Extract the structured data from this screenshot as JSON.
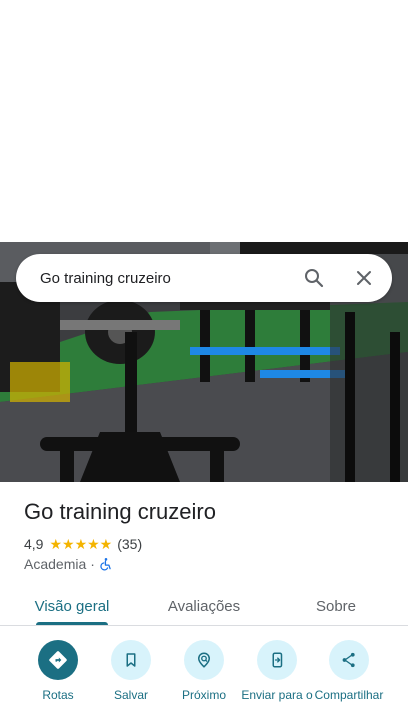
{
  "search": {
    "query": "Go training cruzeiro"
  },
  "place": {
    "title": "Go training cruzeiro",
    "rating": "4,9",
    "stars": "★★★★★",
    "review_count": "(35)",
    "category": "Academia",
    "separator": "·"
  },
  "tabs": [
    {
      "label": "Visão geral",
      "active": true
    },
    {
      "label": "Avaliações",
      "active": false
    },
    {
      "label": "Sobre",
      "active": false
    }
  ],
  "actions": [
    {
      "label": "Rotas",
      "icon": "directions-icon"
    },
    {
      "label": "Salvar",
      "icon": "bookmark-icon"
    },
    {
      "label": "Próximo",
      "icon": "nearby-icon"
    },
    {
      "label": "Enviar para o",
      "icon": "send-to-phone-icon"
    },
    {
      "label": "Compartilhar",
      "icon": "share-icon"
    }
  ],
  "colors": {
    "accent": "#1b6f83",
    "accent_light": "#d8f3fb",
    "star": "#f4b400"
  }
}
